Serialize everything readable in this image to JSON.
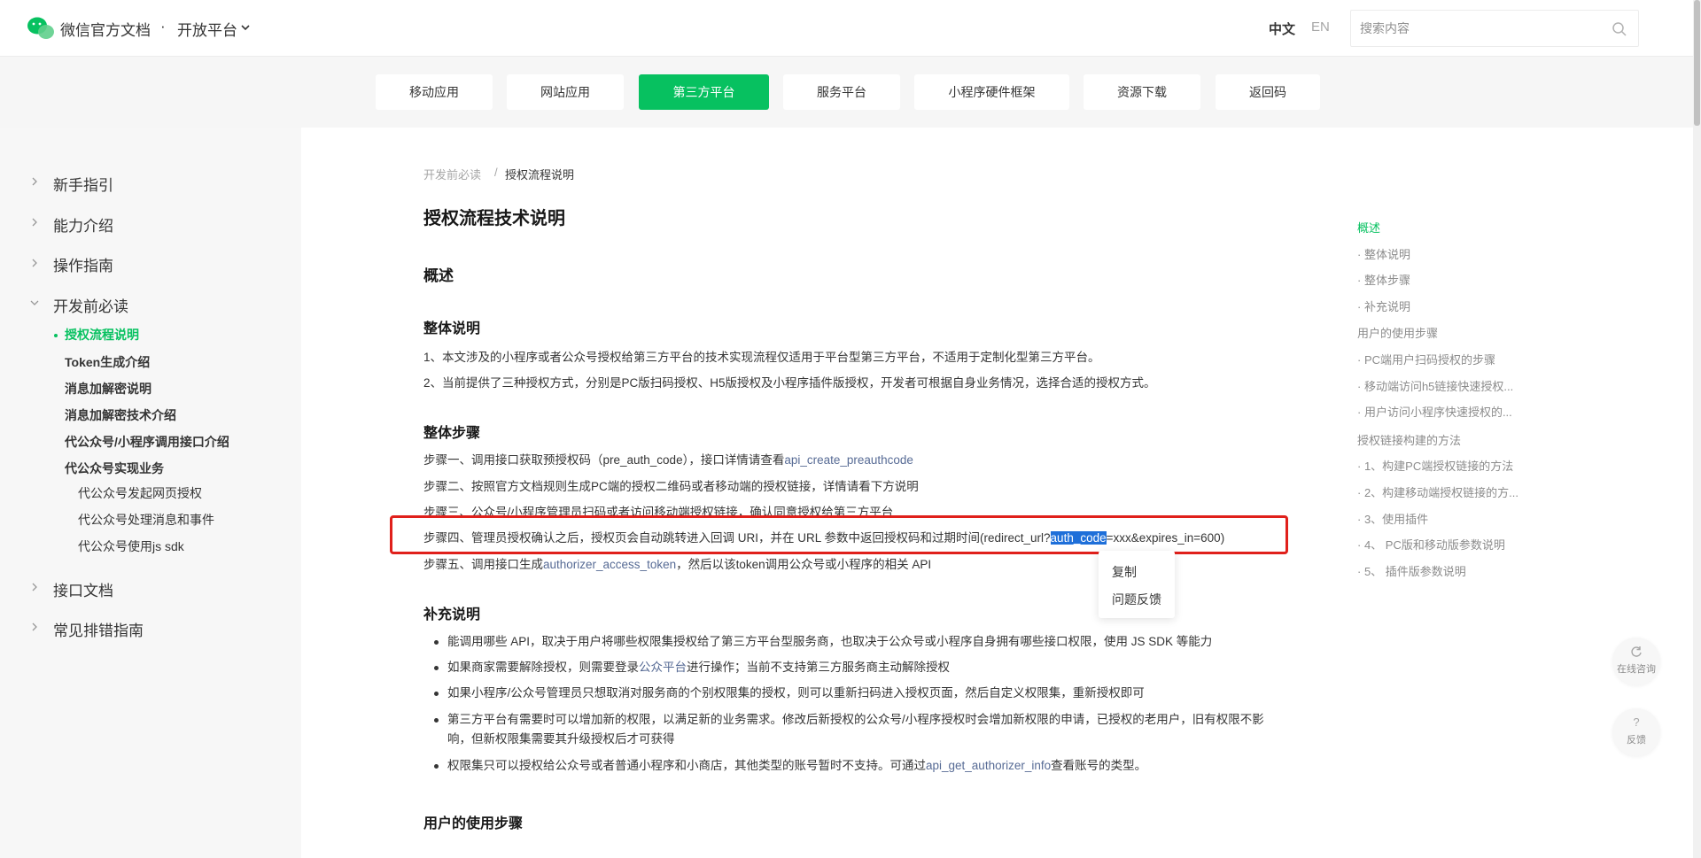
{
  "header": {
    "brand": "微信官方文档",
    "dot": "·",
    "platform": "开放平台",
    "lang_zh": "中文",
    "lang_en": "EN",
    "search_placeholder": "搜索内容"
  },
  "nav": {
    "items": [
      "移动应用",
      "网站应用",
      "第三方平台",
      "服务平台",
      "小程序硬件框架",
      "资源下载",
      "返回码"
    ],
    "active": "第三方平台"
  },
  "sidebar": {
    "items": [
      "新手指引",
      "能力介绍",
      "操作指南",
      "开发前必读",
      "接口文档",
      "常见排错指南"
    ],
    "sub": [
      "授权流程说明",
      "Token生成介绍",
      "消息加解密说明",
      "消息加解密技术介绍",
      "代公众号/小程序调用接口介绍",
      "代公众号实现业务"
    ],
    "subsub": [
      "代公众号发起网页授权",
      "代公众号处理消息和事件",
      "代公众号使用js sdk"
    ]
  },
  "main": {
    "crumb_parent": "开发前必读",
    "crumb_sep": "/",
    "crumb_current": "授权流程说明",
    "title": "授权流程技术说明",
    "overview": "概述",
    "overall_title": "整体说明",
    "overall": [
      "1、本文涉及的小程序或者公众号授权给第三方平台的技术实现流程仅适用于平台型第三方平台，不适用于定制化型第三方平台。",
      "2、当前提供了三种授权方式，分别是PC版扫码授权、H5版授权及小程序插件版授权，开发者可根据自身业务情况，选择合适的授权方式。"
    ],
    "steps_title": "整体步骤",
    "step1_a": "步骤一、调用接口获取预授权码（pre_auth_code），接口详情请查看",
    "step1_link": "api_create_preauthcode",
    "step2": "步骤二、按照官方文档规则生成PC端的授权二维码或者移动端的授权链接，详情请看下方说明",
    "step3": "步骤三、公众号/小程序管理员扫码或者访问移动端授权链接，确认同意授权给第三方平台",
    "step4_a": "步骤四、管理员授权确认之后，授权页会自动跳转进入回调 URI，并在 URL 参数中返回授权码和过期时间(redirect_url?",
    "step4_hl": "auth_code",
    "step4_b": "=xxx&expires_in=600)",
    "step5_a": "步骤五、调用接口生成",
    "step5_link": "authorizer_access_token",
    "step5_b": "，然后以该token调用公众号或小程序的相关 API",
    "supp_title": "补充说明",
    "supp1": "能调用哪些 API，取决于用户将哪些权限集授权给了第三方平台型服务商，也取决于公众号或小程序自身拥有哪些接口权限，使用 JS SDK 等能力",
    "supp2_a": "如果商家需要解除授权，则需要登录",
    "supp2_link": "公众平台",
    "supp2_b": "进行操作；当前不支持第三方服务商主动解除授权",
    "supp3": "如果小程序/公众号管理员只想取消对服务商的个别权限集的授权，则可以重新扫码进入授权页面，然后自定义权限集，重新授权即可",
    "supp4": "第三方平台有需要时可以增加新的权限，以满足新的业务需求。修改后新授权的公众号/小程序授权时会增加新权限的申请，已授权的老用户，旧有权限不影响，但新权限集需要其升级授权后才可获得",
    "supp5_a": "权限集只可以授权给公众号或者普通小程序和小商店，其他类型的账号暂时不支持。可通过",
    "supp5_link": "api_get_authorizer_info",
    "supp5_b": "查看账号的类型。",
    "user_steps_title": "用户的使用步骤"
  },
  "context_menu": [
    "复制",
    "问题反馈"
  ],
  "toc": [
    "概述",
    "· 整体说明",
    "· 整体步骤",
    "· 补充说明",
    "用户的使用步骤",
    "· PC端用户扫码授权的步骤",
    "· 移动端访问h5链接快速授权...",
    "· 用户访问小程序快速授权的...",
    "授权链接构建的方法",
    "· 1、构建PC端授权链接的方法",
    "· 2、构建移动端授权链接的方...",
    "· 3、使用插件",
    "· 4、 PC版和移动版参数说明",
    "· 5、 插件版参数说明"
  ],
  "float": {
    "consult_label": "在线咨询",
    "feedback_glyph": "?",
    "feedback_label": "反馈"
  },
  "colors": {
    "accent": "#07c160",
    "link": "#576b95",
    "highlight": "#e0201b"
  }
}
